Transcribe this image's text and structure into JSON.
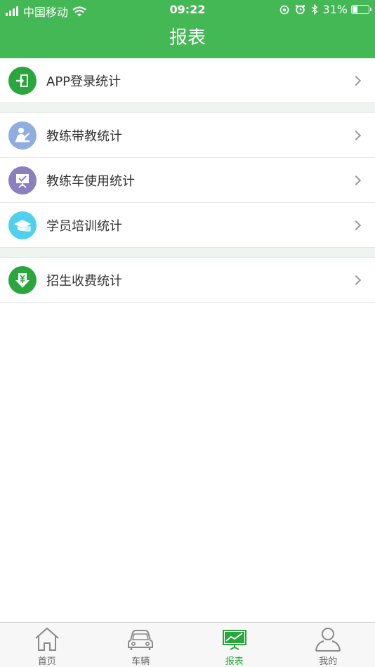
{
  "status_bar": {
    "carrier": "中国移动",
    "time": "09:22",
    "battery_percent": "31%",
    "battery_level": 0.31
  },
  "header": {
    "title": "报表"
  },
  "colors": {
    "brand": "#44b854",
    "tab_active": "#2aa73c"
  },
  "menu": {
    "app_login": {
      "label": "APP登录统计",
      "icon": "login-icon"
    },
    "coach_teaching": {
      "label": "教练带教统计",
      "icon": "teacher-icon"
    },
    "coach_car": {
      "label": "教练车使用统计",
      "icon": "board-icon"
    },
    "student_training": {
      "label": "学员培训统计",
      "icon": "graduation-cap-icon"
    },
    "enrollment_fees": {
      "label": "招生收费统计",
      "icon": "yuan-download-icon"
    }
  },
  "tabbar": {
    "home": {
      "label": "首页",
      "icon": "house-icon"
    },
    "vehicles": {
      "label": "车辆",
      "icon": "car-icon"
    },
    "reports": {
      "label": "报表",
      "icon": "chart-board-icon",
      "active": true
    },
    "mine": {
      "label": "我的",
      "icon": "person-icon"
    }
  }
}
